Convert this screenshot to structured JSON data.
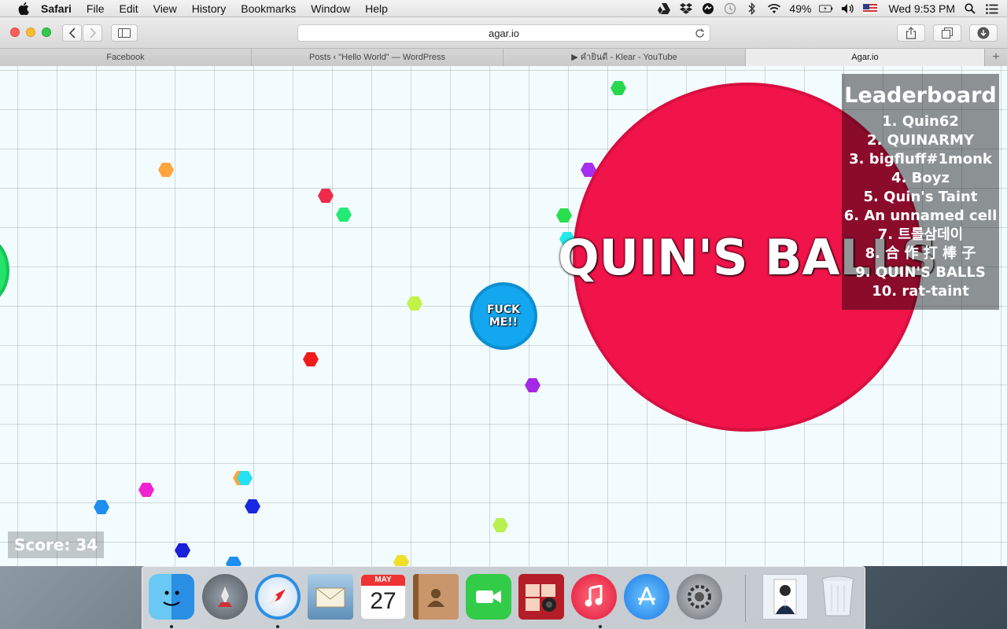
{
  "menubar": {
    "items": [
      "Safari",
      "File",
      "Edit",
      "View",
      "History",
      "Bookmarks",
      "Window",
      "Help"
    ],
    "battery": "49%",
    "clock": "Wed 9:53 PM"
  },
  "browser": {
    "address": "agar.io",
    "tabs": [
      {
        "label": "Facebook"
      },
      {
        "label": "Posts ‹ \"Hello World\" — WordPress"
      },
      {
        "label": "▶ คำยินดี - Klear - YouTube"
      },
      {
        "label": "Agar.io"
      }
    ],
    "new_tab_label": "+"
  },
  "game": {
    "big_cell_name": "QUIN'S BALLS",
    "player_cell_name": "FUCK ME!!",
    "leaderboard": {
      "title": "Leaderboard",
      "entries": [
        "1. Quin62",
        "2. QUINARMY",
        "3. bigfluff#1monk",
        "4. Boyz",
        "5. Quin's Taint",
        "6. An unnamed cell",
        "7. 트롤삼데이",
        "8. 合 作 打 棒 子",
        "9. QUIN'S BALLS",
        "10. rat-taint"
      ]
    },
    "score_text": "Score: 34",
    "colors": {
      "big_cell": "#f0144a",
      "player_cell": "#12a7ef",
      "grid_bg": "#f2fbfd"
    }
  },
  "dock": {
    "apps": [
      "Finder",
      "Launchpad",
      "Safari",
      "Mail",
      "Calendar",
      "Contacts",
      "FaceTime",
      "Photo Booth",
      "iTunes",
      "App Store",
      "System Preferences",
      "Preview",
      "Trash"
    ],
    "calendar_month": "MAY",
    "calendar_day": "27"
  }
}
